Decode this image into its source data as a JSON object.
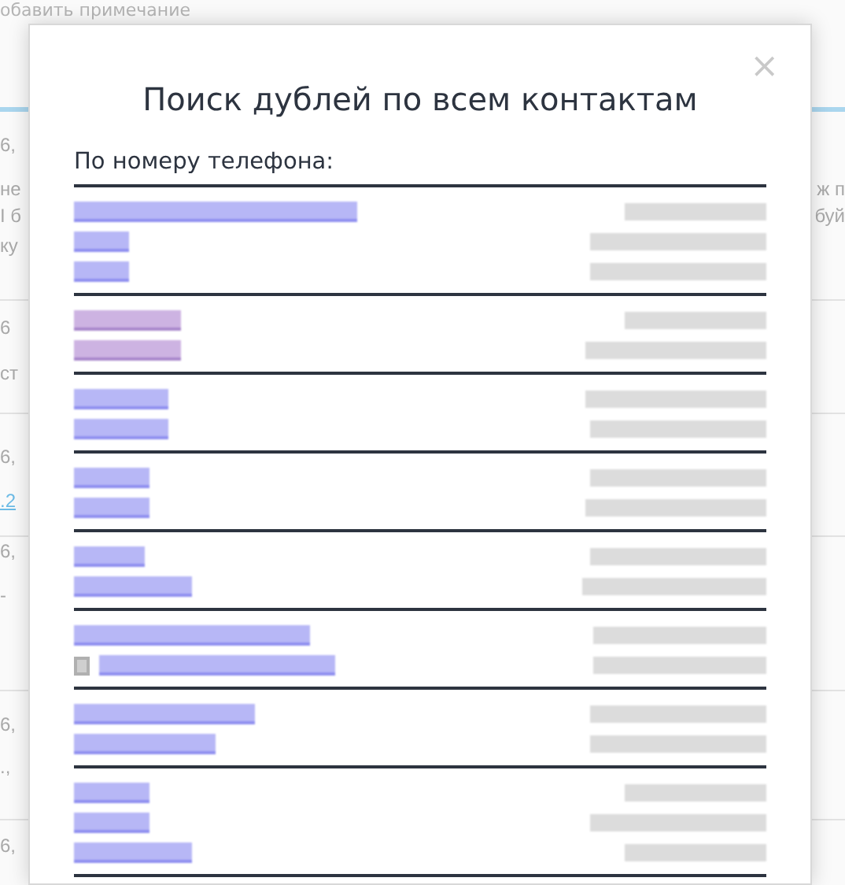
{
  "background": {
    "top_text": "обавить примечание",
    "left_texts": [
      {
        "text": "6,",
        "kind": "plain"
      },
      {
        "text": "не",
        "kind": "plain"
      },
      {
        "text": "I б",
        "kind": "plain"
      },
      {
        "text": "ку",
        "kind": "plain"
      },
      {
        "text": "6",
        "kind": "plain"
      },
      {
        "text": "ст",
        "kind": "plain"
      },
      {
        "text": "6,",
        "kind": "plain"
      },
      {
        "text": ".2",
        "kind": "link"
      },
      {
        "text": "6,",
        "kind": "plain"
      },
      {
        "text": "-",
        "kind": "plain"
      },
      {
        "text": "6,",
        "kind": "plain"
      },
      {
        "text": ".,",
        "kind": "plain"
      },
      {
        "text": "6,",
        "kind": "plain"
      }
    ],
    "right_texts": [
      "ж п",
      "буй"
    ]
  },
  "dialog": {
    "title": "Поиск дублей по всем контактам",
    "close": "×",
    "section_label": "По номеру телефона:",
    "groups": [
      {
        "rows": [
          {
            "visited": false,
            "icon": false
          },
          {
            "visited": false,
            "icon": false
          },
          {
            "visited": false,
            "icon": false
          }
        ]
      },
      {
        "rows": [
          {
            "visited": true,
            "icon": false
          },
          {
            "visited": true,
            "icon": false
          }
        ]
      },
      {
        "rows": [
          {
            "visited": false,
            "icon": false
          },
          {
            "visited": false,
            "icon": false
          }
        ]
      },
      {
        "rows": [
          {
            "visited": false,
            "icon": false
          },
          {
            "visited": false,
            "icon": false
          }
        ]
      },
      {
        "rows": [
          {
            "visited": false,
            "icon": false
          },
          {
            "visited": false,
            "icon": false
          }
        ]
      },
      {
        "rows": [
          {
            "visited": false,
            "icon": false
          },
          {
            "visited": false,
            "icon": true
          }
        ]
      },
      {
        "rows": [
          {
            "visited": false,
            "icon": false
          },
          {
            "visited": false,
            "icon": false
          }
        ]
      },
      {
        "rows": [
          {
            "visited": false,
            "icon": false
          },
          {
            "visited": false,
            "icon": false
          },
          {
            "visited": false,
            "icon": false
          }
        ]
      }
    ]
  }
}
